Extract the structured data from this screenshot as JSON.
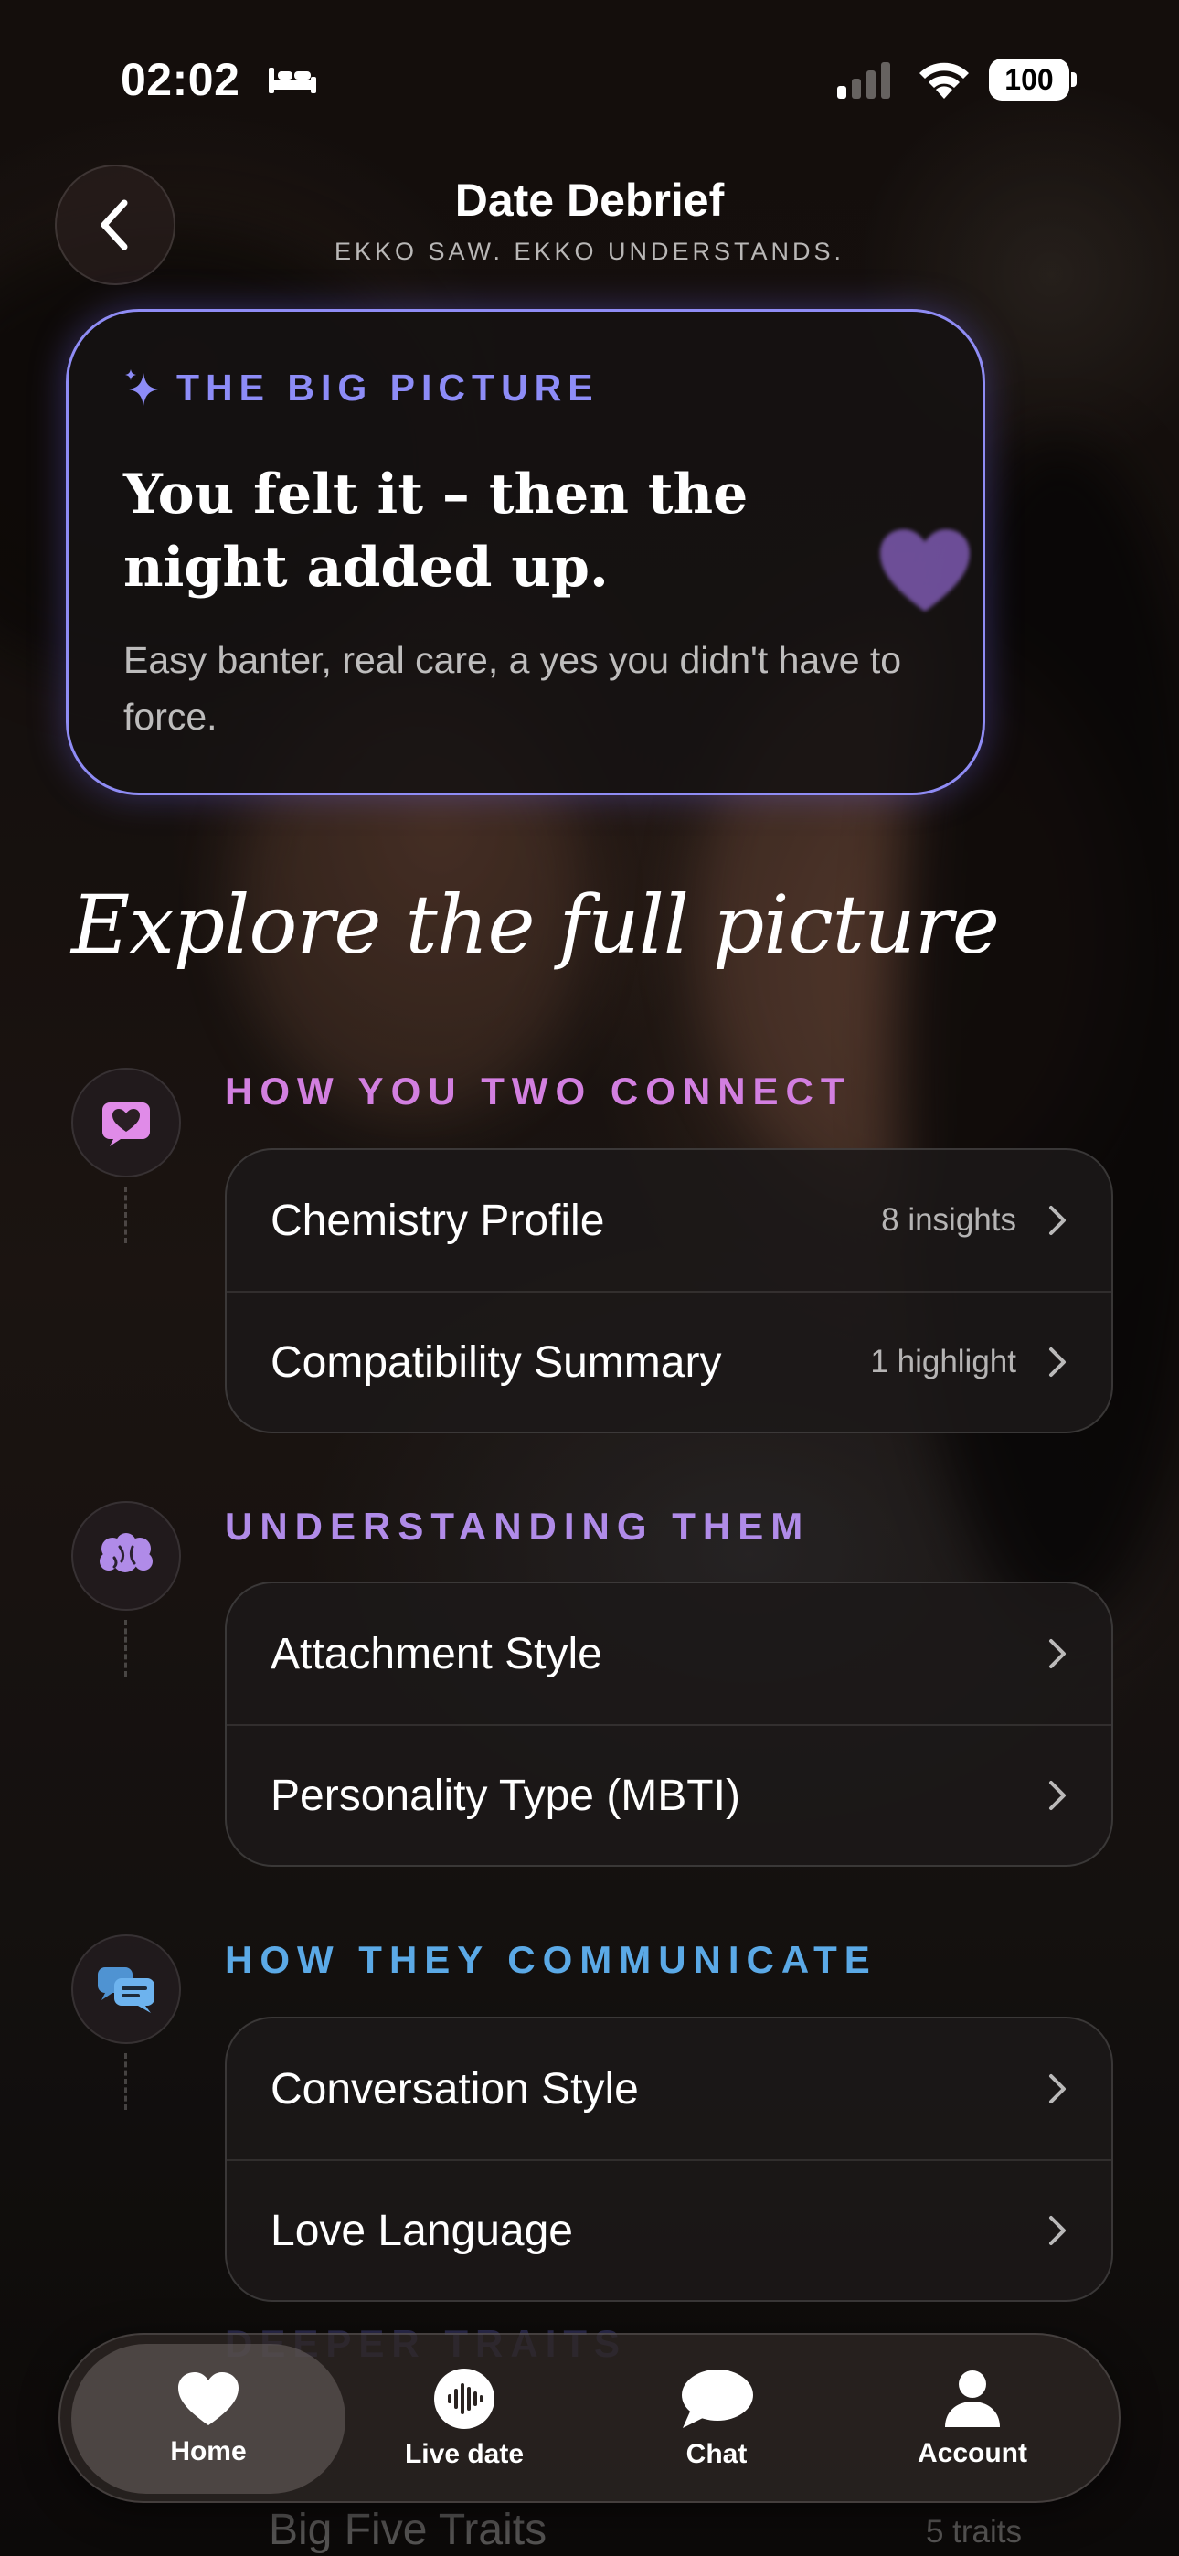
{
  "status_bar": {
    "time": "02:02",
    "battery": "100",
    "icons": [
      "bed-icon",
      "signal-icon",
      "wifi-icon",
      "battery-icon"
    ]
  },
  "header": {
    "title": "Date Debrief",
    "subtitle": "EKKO SAW. EKKO UNDERSTANDS."
  },
  "big_picture": {
    "eyebrow": "THE BIG PICTURE",
    "heading": "You felt it – then the night added up.",
    "body": "Easy banter, real care, a yes you didn't have to force."
  },
  "explore_heading": "Explore the full picture",
  "sections": [
    {
      "label": "HOW YOU TWO CONNECT",
      "color": "#d27fe0",
      "icon": "heart-chat-icon",
      "items": [
        {
          "label": "Chemistry Profile",
          "meta": "8 insights"
        },
        {
          "label": "Compatibility Summary",
          "meta": "1 highlight"
        }
      ]
    },
    {
      "label": "UNDERSTANDING THEM",
      "color": "#b08be8",
      "icon": "brain-icon",
      "items": [
        {
          "label": "Attachment Style",
          "meta": ""
        },
        {
          "label": "Personality Type (MBTI)",
          "meta": ""
        }
      ]
    },
    {
      "label": "HOW THEY COMMUNICATE",
      "color": "#5ba9e6",
      "icon": "chat-bubbles-icon",
      "items": [
        {
          "label": "Conversation Style",
          "meta": ""
        },
        {
          "label": "Love Language",
          "meta": ""
        }
      ]
    }
  ],
  "peek": {
    "label": "DEEPER TRAITS",
    "item": "Big Five Traits",
    "meta": "5 traits"
  },
  "tabbar": {
    "tabs": [
      {
        "label": "Home",
        "icon": "heart-icon",
        "active": true
      },
      {
        "label": "Live date",
        "icon": "audio-wave-icon",
        "active": false
      },
      {
        "label": "Chat",
        "icon": "chat-bubble-icon",
        "active": false
      },
      {
        "label": "Account",
        "icon": "person-icon",
        "active": false
      }
    ]
  },
  "colors": {
    "accent_indigo": "#8d8cf7",
    "connect_pink": "#d27fe0",
    "understand_purple": "#b08be8",
    "communicate_blue": "#5ba9e6"
  }
}
